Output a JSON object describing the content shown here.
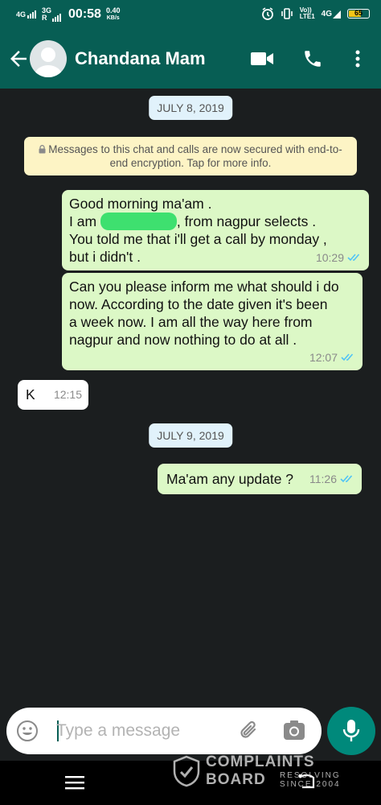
{
  "status_bar": {
    "network_left": "4G",
    "network_left2": "3G",
    "network_left2_sub": "R",
    "time": "00:58",
    "speed_value": "0.40",
    "speed_unit": "KB/s",
    "volte_top": "Vo))",
    "volte_bottom": "LTE1",
    "network_right": "4G",
    "battery": "65",
    "battery_level": 0.65
  },
  "header": {
    "contact_name": "Chandana Mam",
    "icons": [
      "back-arrow-icon",
      "avatar",
      "video-call-icon",
      "phone-icon",
      "more-vert-icon"
    ]
  },
  "chat": {
    "date_1": "JULY 8, 2019",
    "encryption_notice": "Messages to this chat and calls are now secured with end-to-end encryption. Tap for more info.",
    "messages": [
      {
        "direction": "out",
        "line1": "Good morning ma'am .",
        "line2_start": "I am",
        "line2_end": ", from nagpur selects .",
        "line3": "You told me that i'll get a call by monday ,",
        "line4": "but i didn't .",
        "time": "10:29"
      },
      {
        "direction": "out",
        "line1": "Can you please inform me what should i do",
        "line2": "now. According to the date given it's been",
        "line3": "a week now. I am all the way here from",
        "line4": "nagpur and now nothing to do at all .",
        "time": "12:07"
      },
      {
        "direction": "in",
        "text": "K",
        "time": "12:15"
      },
      {
        "direction": "out",
        "text": "Ma'am any update ?",
        "time": "11:26"
      }
    ],
    "date_2": "JULY 9, 2019"
  },
  "composer": {
    "placeholder": "Type a message",
    "icons": [
      "emoji-icon",
      "attach-icon",
      "camera-icon",
      "mic-icon"
    ]
  },
  "watermark": {
    "line1": "COMPLAINTS",
    "line2": "BOARD",
    "tag1": "RESOLVING",
    "tag2": "SINCE 2004"
  },
  "colors": {
    "header": "#075e54",
    "outgoing_bubble": "#dcf8c6",
    "incoming_bubble": "#ffffff",
    "chat_background": "#1b1e1f",
    "read_ticks": "#4fc3f7",
    "date_chip": "#e1f2fb",
    "notice": "#fdf4c5",
    "mic_button": "#00897b"
  }
}
